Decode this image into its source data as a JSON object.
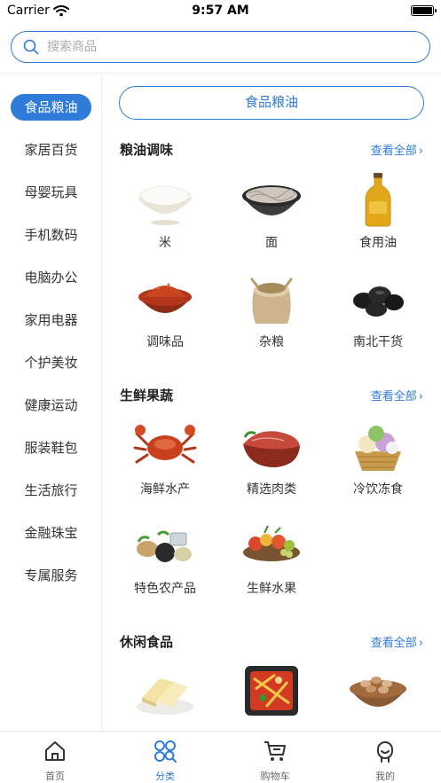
{
  "status_bar": {
    "carrier": "Carrier",
    "time": "9:57 AM"
  },
  "search": {
    "placeholder": "搜索商品"
  },
  "sidebar": {
    "items": [
      {
        "label": "食品粮油",
        "active": true
      },
      {
        "label": "家居百货"
      },
      {
        "label": "母婴玩具"
      },
      {
        "label": "手机数码"
      },
      {
        "label": "电脑办公"
      },
      {
        "label": "家用电器"
      },
      {
        "label": "个护美妆"
      },
      {
        "label": "健康运动"
      },
      {
        "label": "服装鞋包"
      },
      {
        "label": "生活旅行"
      },
      {
        "label": "金融珠宝"
      },
      {
        "label": "专属服务"
      }
    ]
  },
  "content": {
    "banner": "食品粮油",
    "view_all_label": "查看全部",
    "sections": [
      {
        "title": "粮油调味",
        "items": [
          {
            "label": "米",
            "icon": "rice-bowl-icon"
          },
          {
            "label": "面",
            "icon": "noodle-bowl-icon"
          },
          {
            "label": "食用油",
            "icon": "oil-bottle-icon"
          },
          {
            "label": "调味品",
            "icon": "spice-bowl-icon"
          },
          {
            "label": "杂粮",
            "icon": "grain-sack-icon"
          },
          {
            "label": "南北干货",
            "icon": "dried-food-icon"
          }
        ]
      },
      {
        "title": "生鲜果蔬",
        "items": [
          {
            "label": "海鲜水产",
            "icon": "crab-icon"
          },
          {
            "label": "精选肉类",
            "icon": "meat-icon"
          },
          {
            "label": "冷饮冻食",
            "icon": "ice-cream-icon"
          },
          {
            "label": "特色农产品",
            "icon": "produce-icon"
          },
          {
            "label": "生鲜水果",
            "icon": "fruit-bowl-icon"
          }
        ]
      },
      {
        "title": "休闲食品",
        "items": [
          {
            "label": "",
            "icon": "cheese-icon"
          },
          {
            "label": "",
            "icon": "hotpot-box-icon"
          },
          {
            "label": "",
            "icon": "nuts-bowl-icon"
          }
        ]
      }
    ]
  },
  "tabbar": {
    "items": [
      {
        "label": "首页",
        "icon": "home-icon"
      },
      {
        "label": "分类",
        "icon": "category-icon",
        "active": true
      },
      {
        "label": "购物车",
        "icon": "cart-icon"
      },
      {
        "label": "我的",
        "icon": "profile-icon"
      }
    ]
  },
  "colors": {
    "accent": "#2f7bd9",
    "text": "#333333",
    "divider": "#eeeeee"
  }
}
